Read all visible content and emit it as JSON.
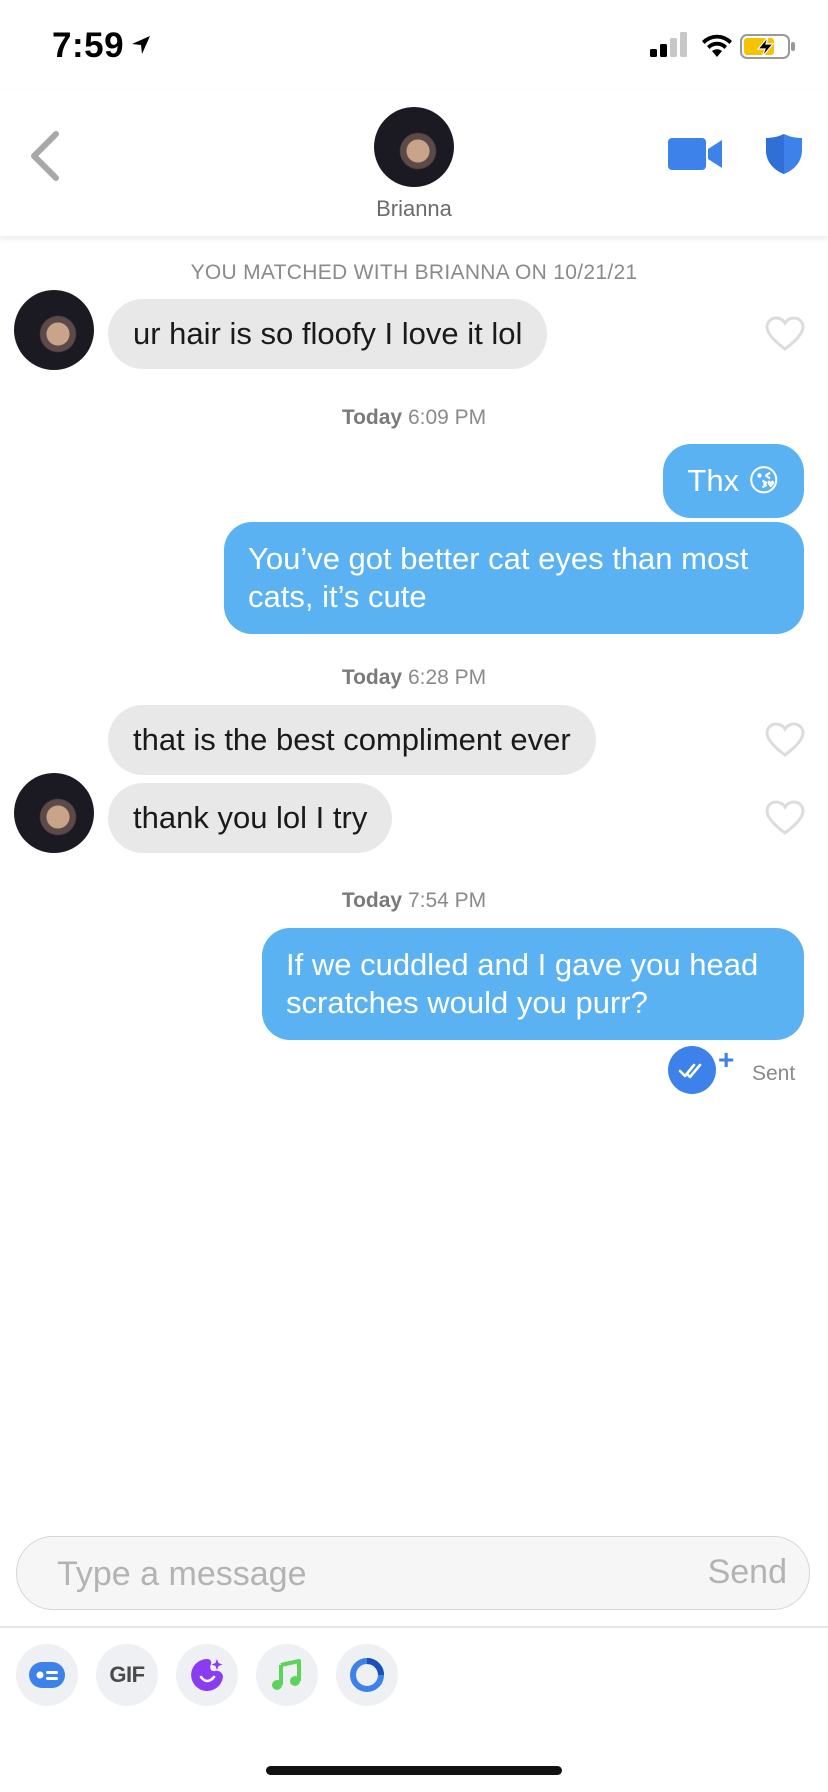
{
  "status_bar": {
    "time": "7:59"
  },
  "header": {
    "name": "Brianna"
  },
  "conversation": {
    "match_notice": "YOU MATCHED WITH BRIANNA ON 10/21/21",
    "messages": [
      {
        "from": "them",
        "text": "ur hair is so floofy I love it lol"
      },
      {
        "from": "me",
        "text": "Thx 😘"
      },
      {
        "from": "me",
        "text": "You’ve got better cat eyes than most cats, it’s cute"
      },
      {
        "from": "them",
        "text": "that is the best compliment ever"
      },
      {
        "from": "them",
        "text": "thank you lol I try"
      },
      {
        "from": "me",
        "text": "If we cuddled and I gave you head scratches would you purr?"
      }
    ],
    "timestamps": [
      {
        "day": "Today",
        "time": "6:09 PM"
      },
      {
        "day": "Today",
        "time": "6:28 PM"
      },
      {
        "day": "Today",
        "time": "7:54 PM"
      }
    ],
    "sent_status": "Sent"
  },
  "composer": {
    "placeholder": "Type a message",
    "send_label": "Send"
  },
  "toolbar": {
    "gif_label": "GIF"
  },
  "colors": {
    "outgoing_bubble": "#5ab2f2",
    "incoming_bubble": "#e8e8e8",
    "accent_blue": "#3c82ea",
    "spotify_green": "#5dd35b",
    "sticker_purple": "#8a3df0"
  }
}
